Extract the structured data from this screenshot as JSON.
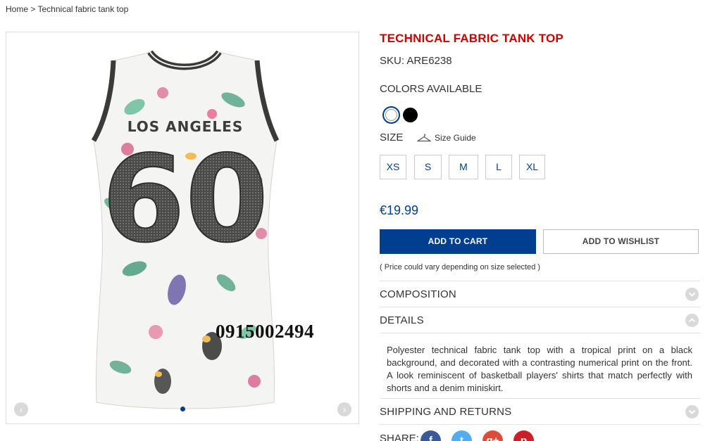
{
  "breadcrumb": {
    "home": "Home",
    "separator": ">",
    "current": "Technical fabric tank top"
  },
  "gallery": {
    "print_top": "LOS ANGELES",
    "print_number": "60",
    "watermark": "0915002494",
    "prev_icon": "chevron-left-icon",
    "next_icon": "chevron-right-icon"
  },
  "product": {
    "title": "TECHNICAL FABRIC TANK TOP",
    "sku": "SKU: ARE6238",
    "colors_label": "COLORS AVAILABLE",
    "colors": [
      {
        "name": "white",
        "hex": "#ffffff",
        "selected": true
      },
      {
        "name": "black",
        "hex": "#000000",
        "selected": false
      }
    ],
    "size_label": "SIZE",
    "size_guide": "Size Guide",
    "sizes": [
      "XS",
      "S",
      "M",
      "L",
      "XL"
    ],
    "price": "€19.99",
    "add_to_cart": "ADD TO CART",
    "add_to_wishlist": "ADD TO WISHLIST",
    "price_note": "( Price could vary depending on size selected )"
  },
  "accordion": {
    "composition": "COMPOSITION",
    "details": "DETAILS",
    "details_text": "Polyester technical fabric tank top with a tropical print on a black background, and decorated with a contrasting numerical print on the front. A look reminiscent of basketball players' shirts that match perfectly with shorts and a denim miniskirt.",
    "shipping": "SHIPPING AND RETURNS"
  },
  "share": {
    "label": "SHARE:",
    "networks": [
      {
        "name": "facebook",
        "glyph": "f",
        "color": "#3b5998"
      },
      {
        "name": "twitter",
        "glyph": "t",
        "color": "#55acee"
      },
      {
        "name": "google-plus",
        "glyph": "g+",
        "color": "#dd4b39"
      },
      {
        "name": "pinterest",
        "glyph": "p",
        "color": "#cb2027"
      }
    ]
  },
  "colors": {
    "accent": "#003f8f",
    "title": "#cc0000"
  }
}
